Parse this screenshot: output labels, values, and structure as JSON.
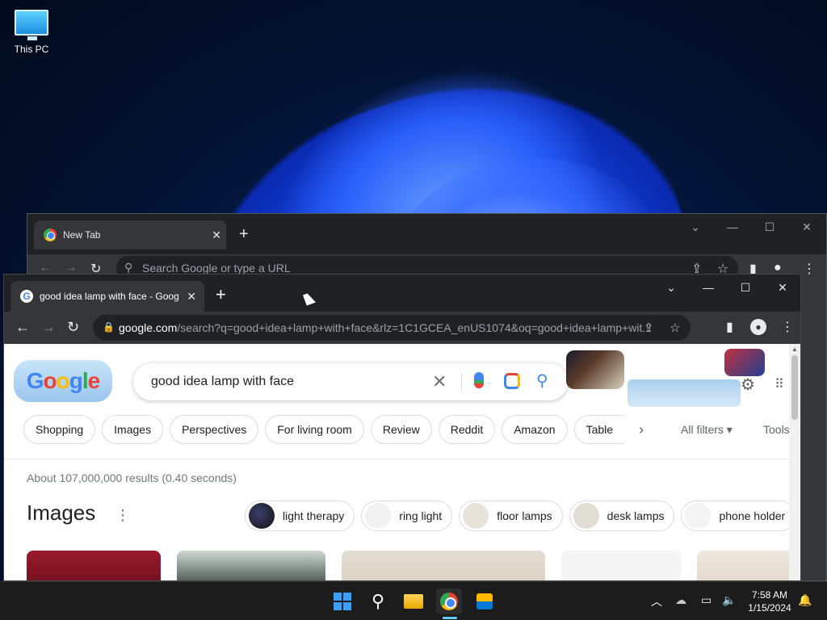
{
  "desktop": {
    "icons": [
      {
        "label": "This PC",
        "icon": "this-pc-icon"
      }
    ]
  },
  "back_window": {
    "tab_title": "New Tab",
    "omnibox_placeholder": "Search Google or type a URL"
  },
  "front_window": {
    "tab_title": "good idea lamp with face - Goog",
    "url_domain": "google.com",
    "url_rest": "/search?q=good+idea+lamp+with+face&rlz=1C1GCEA_enUS1074&oq=good+idea+lamp+wit..."
  },
  "google": {
    "logo_text": "Google",
    "query": "good idea lamp with face",
    "chips": [
      "Shopping",
      "Images",
      "Perspectives",
      "For living room",
      "Review",
      "Reddit",
      "Amazon",
      "Table"
    ],
    "all_filters": "All filters",
    "tools": "Tools",
    "result_stats": "About 107,000,000 results (0.40 seconds)",
    "images_heading": "Images",
    "image_chips": [
      "light therapy",
      "ring light",
      "floor lamps",
      "desk lamps",
      "phone holder"
    ],
    "colors": {
      "blue": "#4285f4",
      "red": "#ea4335",
      "yellow": "#fbbc05",
      "green": "#34a853"
    }
  },
  "taskbar": {
    "apps": [
      "start-icon",
      "search-icon",
      "file-explorer-icon",
      "chrome-icon",
      "microsoft-store-icon"
    ],
    "time": "7:58 AM",
    "date": "1/15/2024"
  }
}
